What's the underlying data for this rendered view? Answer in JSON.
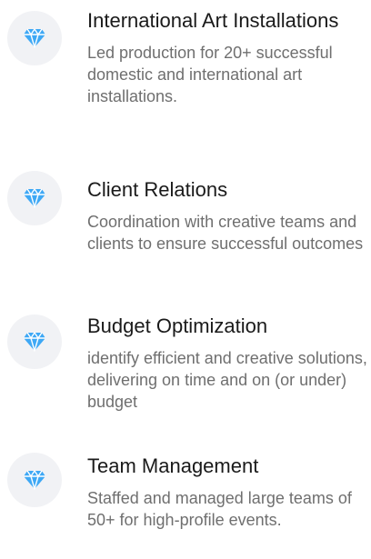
{
  "items": [
    {
      "icon": "diamond-icon",
      "title": "International Art Installations",
      "description": "Led production for 20+ successful domestic and international art installations."
    },
    {
      "icon": "diamond-icon",
      "title": "Client Relations",
      "description": "Coordination with creative teams and clients to ensure successful outcomes"
    },
    {
      "icon": "diamond-icon",
      "title": "Budget Optimization",
      "description": "identify efficient and creative solutions, delivering on time and on (or under) budget"
    },
    {
      "icon": "diamond-icon",
      "title": "Team Management",
      "description": "Staffed and managed large teams of 50+ for high-profile events."
    }
  ],
  "colors": {
    "icon_fill": "#3ea8f5",
    "icon_circle": "#f1f2f5",
    "title_text": "#1a1a1a",
    "description_text": "#6f6f6f"
  }
}
